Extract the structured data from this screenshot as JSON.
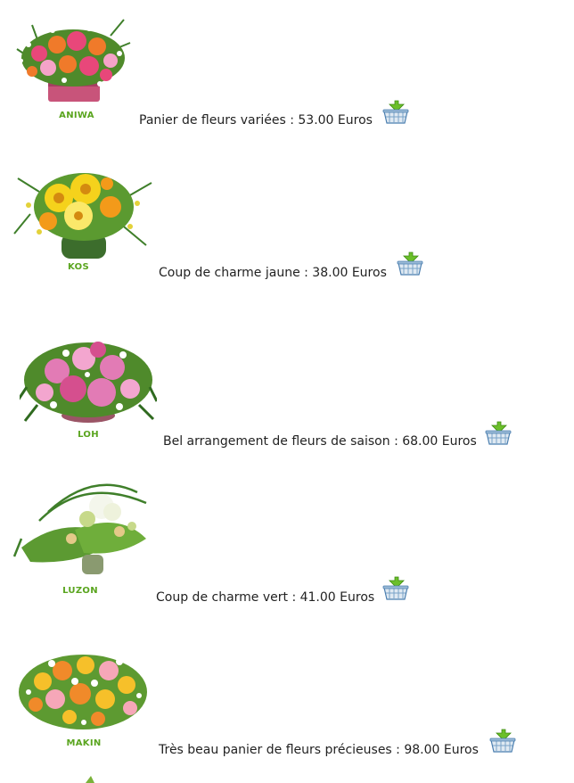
{
  "products": [
    {
      "code": "ANIWA",
      "description": "Panier de fleurs variées : 53.00 Euros",
      "cart_icon": "basket-download-icon",
      "colors": [
        "#e8477a",
        "#f07a2a",
        "#f5a3c8",
        "#ffffff"
      ]
    },
    {
      "code": "KOS",
      "description": "Coup de charme jaune : 38.00 Euros",
      "cart_icon": "basket-download-icon",
      "colors": [
        "#f5d21c",
        "#f39a1a",
        "#fbe86a",
        "#7ab23a"
      ]
    },
    {
      "code": "LOH",
      "description": "Bel arrangement de fleurs de saison : 68.00 Euros",
      "cart_icon": "basket-download-icon",
      "colors": [
        "#e27bb5",
        "#f3a6cf",
        "#d54f8e",
        "#ffffff"
      ]
    },
    {
      "code": "LUZON",
      "description": "Coup de charme vert : 41.00 Euros",
      "cart_icon": "basket-download-icon",
      "colors": [
        "#f4f6ec",
        "#c7d98a",
        "#e4c989",
        "#ffffff"
      ]
    },
    {
      "code": "MAKIN",
      "description": "Très beau panier de fleurs précieuses : 98.00 Euros",
      "cart_icon": "basket-download-icon",
      "colors": [
        "#f6c02a",
        "#f08a2a",
        "#f6a7b8",
        "#ffffff"
      ]
    }
  ],
  "theme": {
    "code_color": "#5aa51f"
  }
}
